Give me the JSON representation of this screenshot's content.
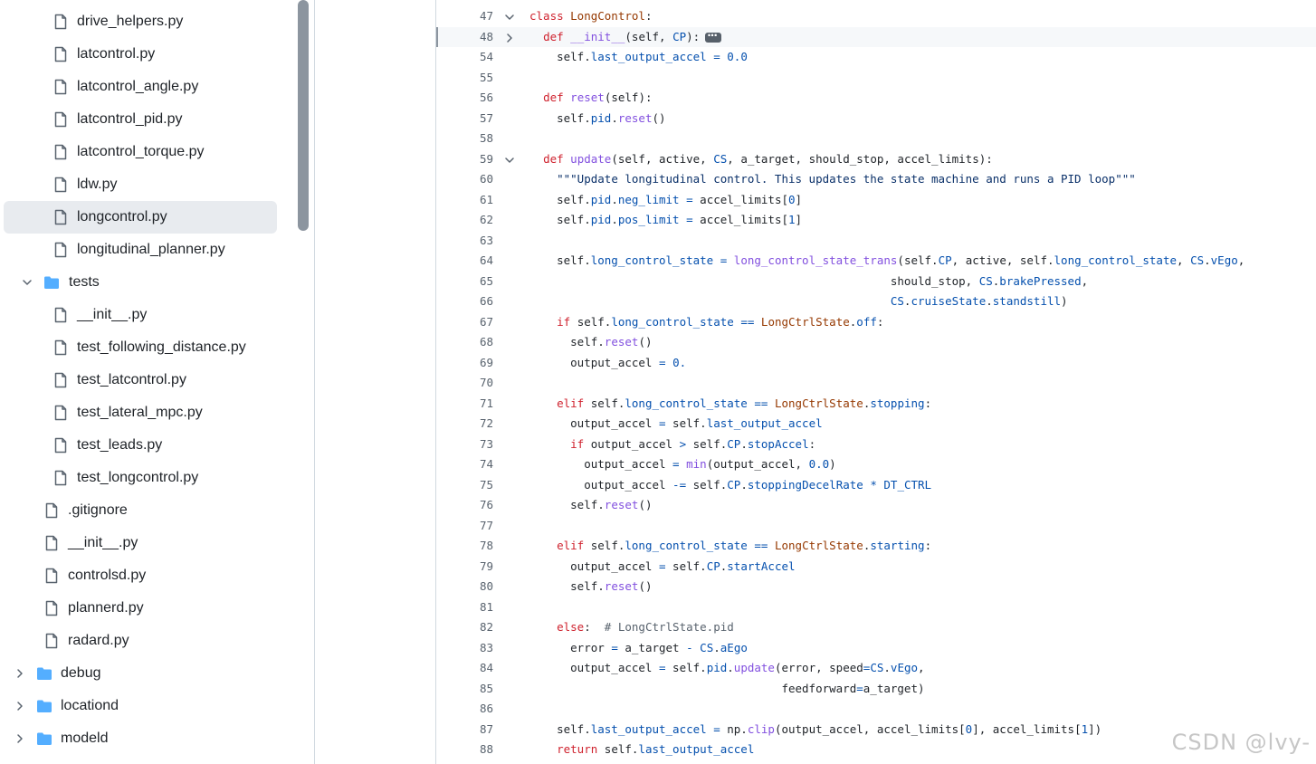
{
  "file_tree": [
    {
      "label": "drive_helpers.py",
      "kind": "file",
      "depth": 2,
      "selected": false,
      "expanded": false
    },
    {
      "label": "latcontrol.py",
      "kind": "file",
      "depth": 2,
      "selected": false,
      "expanded": false
    },
    {
      "label": "latcontrol_angle.py",
      "kind": "file",
      "depth": 2,
      "selected": false,
      "expanded": false
    },
    {
      "label": "latcontrol_pid.py",
      "kind": "file",
      "depth": 2,
      "selected": false,
      "expanded": false
    },
    {
      "label": "latcontrol_torque.py",
      "kind": "file",
      "depth": 2,
      "selected": false,
      "expanded": false
    },
    {
      "label": "ldw.py",
      "kind": "file",
      "depth": 2,
      "selected": false,
      "expanded": false
    },
    {
      "label": "longcontrol.py",
      "kind": "file",
      "depth": 2,
      "selected": true,
      "expanded": false
    },
    {
      "label": "longitudinal_planner.py",
      "kind": "file",
      "depth": 2,
      "selected": false,
      "expanded": false
    },
    {
      "label": "tests",
      "kind": "folder",
      "depth": 1,
      "selected": false,
      "expanded": true
    },
    {
      "label": "__init__.py",
      "kind": "file",
      "depth": 2,
      "selected": false,
      "expanded": false
    },
    {
      "label": "test_following_distance.py",
      "kind": "file",
      "depth": 2,
      "selected": false,
      "expanded": false
    },
    {
      "label": "test_latcontrol.py",
      "kind": "file",
      "depth": 2,
      "selected": false,
      "expanded": false
    },
    {
      "label": "test_lateral_mpc.py",
      "kind": "file",
      "depth": 2,
      "selected": false,
      "expanded": false
    },
    {
      "label": "test_leads.py",
      "kind": "file",
      "depth": 2,
      "selected": false,
      "expanded": false
    },
    {
      "label": "test_longcontrol.py",
      "kind": "file",
      "depth": 2,
      "selected": false,
      "expanded": false
    },
    {
      "label": ".gitignore",
      "kind": "file",
      "depth": 1,
      "selected": false,
      "expanded": false
    },
    {
      "label": "__init__.py",
      "kind": "file",
      "depth": 1,
      "selected": false,
      "expanded": false
    },
    {
      "label": "controlsd.py",
      "kind": "file",
      "depth": 1,
      "selected": false,
      "expanded": false
    },
    {
      "label": "plannerd.py",
      "kind": "file",
      "depth": 1,
      "selected": false,
      "expanded": false
    },
    {
      "label": "radard.py",
      "kind": "file",
      "depth": 1,
      "selected": false,
      "expanded": false
    },
    {
      "label": "debug",
      "kind": "folder",
      "depth": 0,
      "selected": false,
      "expanded": false
    },
    {
      "label": "locationd",
      "kind": "folder",
      "depth": 0,
      "selected": false,
      "expanded": false
    },
    {
      "label": "modeld",
      "kind": "folder",
      "depth": 0,
      "selected": false,
      "expanded": false
    }
  ],
  "code_lines": [
    {
      "n": "47",
      "fold": "open",
      "active": false,
      "tokens": [
        [
          "k",
          "class "
        ],
        [
          "o",
          "LongControl"
        ],
        [
          "",
          ""
        ],
        [
          "",
          ":"
        ]
      ]
    },
    {
      "n": "48",
      "fold": "closed",
      "active": true,
      "collapsed": true,
      "tokens": [
        [
          "",
          "  "
        ],
        [
          "k",
          "def "
        ],
        [
          "f",
          "__init__"
        ],
        [
          "",
          "(self, "
        ],
        [
          "p",
          "CP"
        ],
        [
          "",
          "):"
        ]
      ]
    },
    {
      "n": "54",
      "tokens": [
        [
          "",
          "    self."
        ],
        [
          "p",
          "last_output_accel"
        ],
        [
          "",
          " "
        ],
        [
          "p",
          "="
        ],
        [
          "",
          " "
        ],
        [
          "p",
          "0.0"
        ]
      ]
    },
    {
      "n": "55",
      "tokens": []
    },
    {
      "n": "56",
      "tokens": [
        [
          "",
          "  "
        ],
        [
          "k",
          "def "
        ],
        [
          "f",
          "reset"
        ],
        [
          "",
          "(self):"
        ]
      ]
    },
    {
      "n": "57",
      "tokens": [
        [
          "",
          "    self."
        ],
        [
          "p",
          "pid"
        ],
        [
          "",
          "."
        ],
        [
          "f",
          "reset"
        ],
        [
          "",
          "()"
        ]
      ]
    },
    {
      "n": "58",
      "tokens": []
    },
    {
      "n": "59",
      "fold": "open",
      "tokens": [
        [
          "",
          "  "
        ],
        [
          "k",
          "def "
        ],
        [
          "f",
          "update"
        ],
        [
          "",
          "(self, active, "
        ],
        [
          "p",
          "CS"
        ],
        [
          "",
          ", a_target, should_stop, accel_limits):"
        ]
      ]
    },
    {
      "n": "60",
      "tokens": [
        [
          "",
          "    "
        ],
        [
          "s",
          "\"\"\"Update longitudinal control. This updates the state machine and runs a PID loop\"\"\""
        ]
      ]
    },
    {
      "n": "61",
      "tokens": [
        [
          "",
          "    self."
        ],
        [
          "p",
          "pid"
        ],
        [
          "",
          "."
        ],
        [
          "p",
          "neg_limit"
        ],
        [
          "",
          " "
        ],
        [
          "p",
          "="
        ],
        [
          "",
          " accel_limits["
        ],
        [
          "p",
          "0"
        ],
        [
          "",
          "]"
        ]
      ]
    },
    {
      "n": "62",
      "tokens": [
        [
          "",
          "    self."
        ],
        [
          "p",
          "pid"
        ],
        [
          "",
          "."
        ],
        [
          "p",
          "pos_limit"
        ],
        [
          "",
          " "
        ],
        [
          "p",
          "="
        ],
        [
          "",
          " accel_limits["
        ],
        [
          "p",
          "1"
        ],
        [
          "",
          "]"
        ]
      ]
    },
    {
      "n": "63",
      "tokens": []
    },
    {
      "n": "64",
      "tokens": [
        [
          "",
          "    self."
        ],
        [
          "p",
          "long_control_state"
        ],
        [
          "",
          " "
        ],
        [
          "p",
          "="
        ],
        [
          "",
          " "
        ],
        [
          "f",
          "long_control_state_trans"
        ],
        [
          "",
          "(self."
        ],
        [
          "p",
          "CP"
        ],
        [
          "",
          ", active, self."
        ],
        [
          "p",
          "long_control_state"
        ],
        [
          "",
          ", "
        ],
        [
          "p",
          "CS"
        ],
        [
          "",
          "."
        ],
        [
          "p",
          "vEgo"
        ],
        [
          "",
          ","
        ]
      ]
    },
    {
      "n": "65",
      "tokens": [
        [
          "",
          "                                                     should_stop, "
        ],
        [
          "p",
          "CS"
        ],
        [
          "",
          "."
        ],
        [
          "p",
          "brakePressed"
        ],
        [
          "",
          ","
        ]
      ]
    },
    {
      "n": "66",
      "tokens": [
        [
          "",
          "                                                     "
        ],
        [
          "p",
          "CS"
        ],
        [
          "",
          "."
        ],
        [
          "p",
          "cruiseState"
        ],
        [
          "",
          "."
        ],
        [
          "p",
          "standstill"
        ],
        [
          "",
          ")"
        ]
      ]
    },
    {
      "n": "67",
      "tokens": [
        [
          "",
          "    "
        ],
        [
          "k",
          "if"
        ],
        [
          "",
          " self."
        ],
        [
          "p",
          "long_control_state"
        ],
        [
          "",
          " "
        ],
        [
          "p",
          "=="
        ],
        [
          "",
          " "
        ],
        [
          "o",
          "LongCtrlState"
        ],
        [
          "",
          "."
        ],
        [
          "p",
          "off"
        ],
        [
          "",
          ":"
        ]
      ]
    },
    {
      "n": "68",
      "tokens": [
        [
          "",
          "      self."
        ],
        [
          "f",
          "reset"
        ],
        [
          "",
          "()"
        ]
      ]
    },
    {
      "n": "69",
      "tokens": [
        [
          "",
          "      output_accel "
        ],
        [
          "p",
          "="
        ],
        [
          "",
          " "
        ],
        [
          "p",
          "0."
        ]
      ]
    },
    {
      "n": "70",
      "tokens": []
    },
    {
      "n": "71",
      "tokens": [
        [
          "",
          "    "
        ],
        [
          "k",
          "elif"
        ],
        [
          "",
          " self."
        ],
        [
          "p",
          "long_control_state"
        ],
        [
          "",
          " "
        ],
        [
          "p",
          "=="
        ],
        [
          "",
          " "
        ],
        [
          "o",
          "LongCtrlState"
        ],
        [
          "",
          "."
        ],
        [
          "p",
          "stopping"
        ],
        [
          "",
          ":"
        ]
      ]
    },
    {
      "n": "72",
      "tokens": [
        [
          "",
          "      output_accel "
        ],
        [
          "p",
          "="
        ],
        [
          "",
          " self."
        ],
        [
          "p",
          "last_output_accel"
        ]
      ]
    },
    {
      "n": "73",
      "tokens": [
        [
          "",
          "      "
        ],
        [
          "k",
          "if"
        ],
        [
          "",
          " output_accel "
        ],
        [
          "p",
          ">"
        ],
        [
          "",
          " self."
        ],
        [
          "p",
          "CP"
        ],
        [
          "",
          "."
        ],
        [
          "p",
          "stopAccel"
        ],
        [
          "",
          ":"
        ]
      ]
    },
    {
      "n": "74",
      "tokens": [
        [
          "",
          "        output_accel "
        ],
        [
          "p",
          "="
        ],
        [
          "",
          " "
        ],
        [
          "f",
          "min"
        ],
        [
          "",
          "(output_accel, "
        ],
        [
          "p",
          "0.0"
        ],
        [
          "",
          ")"
        ]
      ]
    },
    {
      "n": "75",
      "tokens": [
        [
          "",
          "        output_accel "
        ],
        [
          "p",
          "-="
        ],
        [
          "",
          " self."
        ],
        [
          "p",
          "CP"
        ],
        [
          "",
          "."
        ],
        [
          "p",
          "stoppingDecelRate"
        ],
        [
          "",
          " "
        ],
        [
          "p",
          "*"
        ],
        [
          "",
          " "
        ],
        [
          "p",
          "DT_CTRL"
        ]
      ]
    },
    {
      "n": "76",
      "tokens": [
        [
          "",
          "      self."
        ],
        [
          "f",
          "reset"
        ],
        [
          "",
          "()"
        ]
      ]
    },
    {
      "n": "77",
      "tokens": []
    },
    {
      "n": "78",
      "tokens": [
        [
          "",
          "    "
        ],
        [
          "k",
          "elif"
        ],
        [
          "",
          " self."
        ],
        [
          "p",
          "long_control_state"
        ],
        [
          "",
          " "
        ],
        [
          "p",
          "=="
        ],
        [
          "",
          " "
        ],
        [
          "o",
          "LongCtrlState"
        ],
        [
          "",
          "."
        ],
        [
          "p",
          "starting"
        ],
        [
          "",
          ":"
        ]
      ]
    },
    {
      "n": "79",
      "tokens": [
        [
          "",
          "      output_accel "
        ],
        [
          "p",
          "="
        ],
        [
          "",
          " self."
        ],
        [
          "p",
          "CP"
        ],
        [
          "",
          "."
        ],
        [
          "p",
          "startAccel"
        ]
      ]
    },
    {
      "n": "80",
      "tokens": [
        [
          "",
          "      self."
        ],
        [
          "f",
          "reset"
        ],
        [
          "",
          "()"
        ]
      ]
    },
    {
      "n": "81",
      "tokens": []
    },
    {
      "n": "82",
      "tokens": [
        [
          "",
          "    "
        ],
        [
          "k",
          "else"
        ],
        [
          "",
          ":  "
        ],
        [
          "c",
          "# LongCtrlState.pid"
        ]
      ]
    },
    {
      "n": "83",
      "tokens": [
        [
          "",
          "      error "
        ],
        [
          "p",
          "="
        ],
        [
          "",
          " a_target "
        ],
        [
          "p",
          "-"
        ],
        [
          "",
          " "
        ],
        [
          "p",
          "CS"
        ],
        [
          "",
          "."
        ],
        [
          "p",
          "aEgo"
        ]
      ]
    },
    {
      "n": "84",
      "tokens": [
        [
          "",
          "      output_accel "
        ],
        [
          "p",
          "="
        ],
        [
          "",
          " self."
        ],
        [
          "p",
          "pid"
        ],
        [
          "",
          "."
        ],
        [
          "f",
          "update"
        ],
        [
          "",
          "(error, speed"
        ],
        [
          "p",
          "="
        ],
        [
          "p",
          "CS"
        ],
        [
          "",
          "."
        ],
        [
          "p",
          "vEgo"
        ],
        [
          "",
          ","
        ]
      ]
    },
    {
      "n": "85",
      "tokens": [
        [
          "",
          "                                     feedforward"
        ],
        [
          "p",
          "="
        ],
        [
          "",
          "a_target)"
        ]
      ]
    },
    {
      "n": "86",
      "tokens": []
    },
    {
      "n": "87",
      "tokens": [
        [
          "",
          "    self."
        ],
        [
          "p",
          "last_output_accel"
        ],
        [
          "",
          " "
        ],
        [
          "p",
          "="
        ],
        [
          "",
          " np."
        ],
        [
          "f",
          "clip"
        ],
        [
          "",
          "(output_accel, accel_limits["
        ],
        [
          "p",
          "0"
        ],
        [
          "",
          "], accel_limits["
        ],
        [
          "p",
          "1"
        ],
        [
          "",
          "])"
        ]
      ]
    },
    {
      "n": "88",
      "tokens": [
        [
          "",
          "    "
        ],
        [
          "k",
          "return"
        ],
        [
          "",
          " self."
        ],
        [
          "p",
          "last_output_accel"
        ]
      ]
    }
  ],
  "watermark": "CSDN @lvy-"
}
